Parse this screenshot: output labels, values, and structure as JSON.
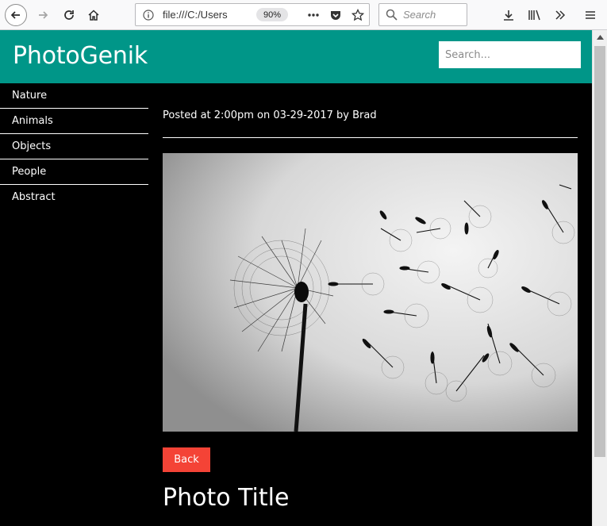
{
  "browser": {
    "url": "file:///C:/Users",
    "zoom": "90%",
    "search_placeholder": "Search"
  },
  "site": {
    "brand": "PhotoGenik",
    "search_placeholder": "Search..."
  },
  "sidebar": {
    "items": [
      {
        "label": "Nature"
      },
      {
        "label": "Animals"
      },
      {
        "label": "Objects"
      },
      {
        "label": "People"
      },
      {
        "label": "Abstract"
      }
    ]
  },
  "post": {
    "meta": "Posted at 2:00pm on 03-29-2017 by Brad",
    "back_label": "Back",
    "title": "Photo Title",
    "image_subject": "dandelion-photo"
  },
  "colors": {
    "header": "#009688",
    "back_button": "#f44336",
    "page_bg": "#000000"
  }
}
